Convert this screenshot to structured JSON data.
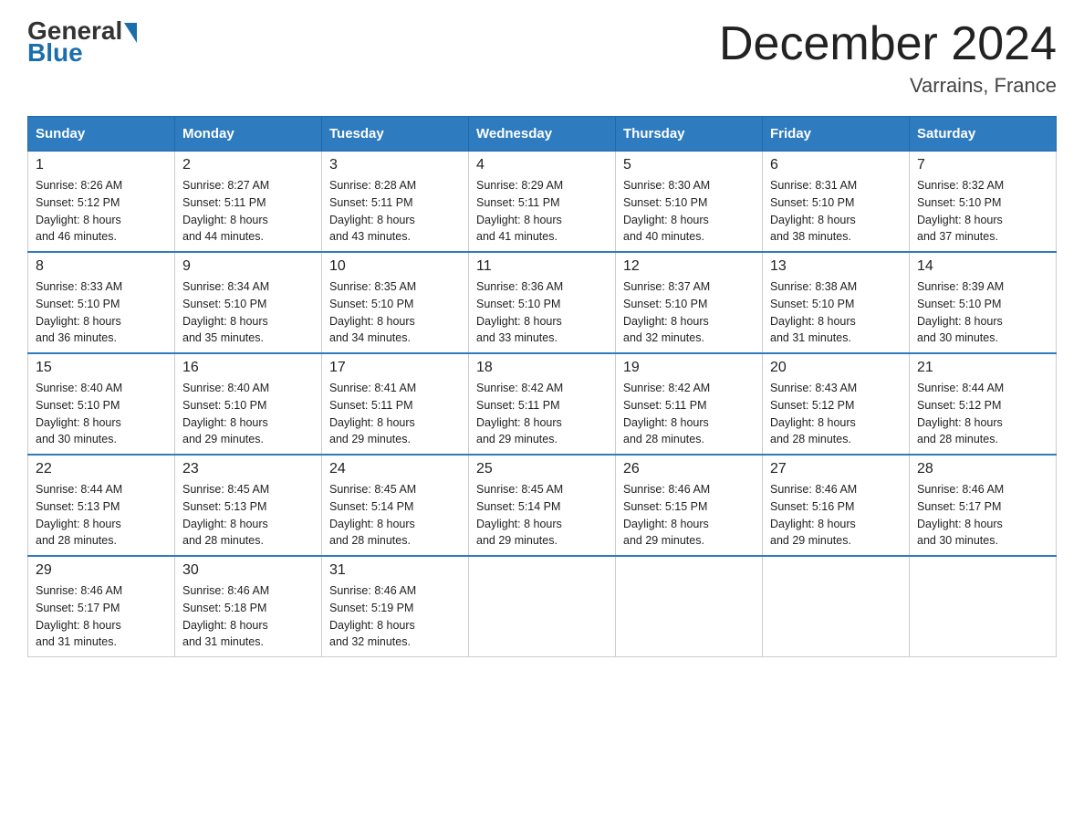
{
  "header": {
    "logo_line1": "General",
    "logo_line2": "Blue",
    "month_title": "December 2024",
    "location": "Varrains, France"
  },
  "days_of_week": [
    "Sunday",
    "Monday",
    "Tuesday",
    "Wednesday",
    "Thursday",
    "Friday",
    "Saturday"
  ],
  "weeks": [
    [
      {
        "day": "1",
        "sunrise": "8:26 AM",
        "sunset": "5:12 PM",
        "daylight": "8 hours and 46 minutes."
      },
      {
        "day": "2",
        "sunrise": "8:27 AM",
        "sunset": "5:11 PM",
        "daylight": "8 hours and 44 minutes."
      },
      {
        "day": "3",
        "sunrise": "8:28 AM",
        "sunset": "5:11 PM",
        "daylight": "8 hours and 43 minutes."
      },
      {
        "day": "4",
        "sunrise": "8:29 AM",
        "sunset": "5:11 PM",
        "daylight": "8 hours and 41 minutes."
      },
      {
        "day": "5",
        "sunrise": "8:30 AM",
        "sunset": "5:10 PM",
        "daylight": "8 hours and 40 minutes."
      },
      {
        "day": "6",
        "sunrise": "8:31 AM",
        "sunset": "5:10 PM",
        "daylight": "8 hours and 38 minutes."
      },
      {
        "day": "7",
        "sunrise": "8:32 AM",
        "sunset": "5:10 PM",
        "daylight": "8 hours and 37 minutes."
      }
    ],
    [
      {
        "day": "8",
        "sunrise": "8:33 AM",
        "sunset": "5:10 PM",
        "daylight": "8 hours and 36 minutes."
      },
      {
        "day": "9",
        "sunrise": "8:34 AM",
        "sunset": "5:10 PM",
        "daylight": "8 hours and 35 minutes."
      },
      {
        "day": "10",
        "sunrise": "8:35 AM",
        "sunset": "5:10 PM",
        "daylight": "8 hours and 34 minutes."
      },
      {
        "day": "11",
        "sunrise": "8:36 AM",
        "sunset": "5:10 PM",
        "daylight": "8 hours and 33 minutes."
      },
      {
        "day": "12",
        "sunrise": "8:37 AM",
        "sunset": "5:10 PM",
        "daylight": "8 hours and 32 minutes."
      },
      {
        "day": "13",
        "sunrise": "8:38 AM",
        "sunset": "5:10 PM",
        "daylight": "8 hours and 31 minutes."
      },
      {
        "day": "14",
        "sunrise": "8:39 AM",
        "sunset": "5:10 PM",
        "daylight": "8 hours and 30 minutes."
      }
    ],
    [
      {
        "day": "15",
        "sunrise": "8:40 AM",
        "sunset": "5:10 PM",
        "daylight": "8 hours and 30 minutes."
      },
      {
        "day": "16",
        "sunrise": "8:40 AM",
        "sunset": "5:10 PM",
        "daylight": "8 hours and 29 minutes."
      },
      {
        "day": "17",
        "sunrise": "8:41 AM",
        "sunset": "5:11 PM",
        "daylight": "8 hours and 29 minutes."
      },
      {
        "day": "18",
        "sunrise": "8:42 AM",
        "sunset": "5:11 PM",
        "daylight": "8 hours and 29 minutes."
      },
      {
        "day": "19",
        "sunrise": "8:42 AM",
        "sunset": "5:11 PM",
        "daylight": "8 hours and 28 minutes."
      },
      {
        "day": "20",
        "sunrise": "8:43 AM",
        "sunset": "5:12 PM",
        "daylight": "8 hours and 28 minutes."
      },
      {
        "day": "21",
        "sunrise": "8:44 AM",
        "sunset": "5:12 PM",
        "daylight": "8 hours and 28 minutes."
      }
    ],
    [
      {
        "day": "22",
        "sunrise": "8:44 AM",
        "sunset": "5:13 PM",
        "daylight": "8 hours and 28 minutes."
      },
      {
        "day": "23",
        "sunrise": "8:45 AM",
        "sunset": "5:13 PM",
        "daylight": "8 hours and 28 minutes."
      },
      {
        "day": "24",
        "sunrise": "8:45 AM",
        "sunset": "5:14 PM",
        "daylight": "8 hours and 28 minutes."
      },
      {
        "day": "25",
        "sunrise": "8:45 AM",
        "sunset": "5:14 PM",
        "daylight": "8 hours and 29 minutes."
      },
      {
        "day": "26",
        "sunrise": "8:46 AM",
        "sunset": "5:15 PM",
        "daylight": "8 hours and 29 minutes."
      },
      {
        "day": "27",
        "sunrise": "8:46 AM",
        "sunset": "5:16 PM",
        "daylight": "8 hours and 29 minutes."
      },
      {
        "day": "28",
        "sunrise": "8:46 AM",
        "sunset": "5:17 PM",
        "daylight": "8 hours and 30 minutes."
      }
    ],
    [
      {
        "day": "29",
        "sunrise": "8:46 AM",
        "sunset": "5:17 PM",
        "daylight": "8 hours and 31 minutes."
      },
      {
        "day": "30",
        "sunrise": "8:46 AM",
        "sunset": "5:18 PM",
        "daylight": "8 hours and 31 minutes."
      },
      {
        "day": "31",
        "sunrise": "8:46 AM",
        "sunset": "5:19 PM",
        "daylight": "8 hours and 32 minutes."
      },
      null,
      null,
      null,
      null
    ]
  ],
  "labels": {
    "sunrise": "Sunrise:",
    "sunset": "Sunset:",
    "daylight": "Daylight:"
  }
}
